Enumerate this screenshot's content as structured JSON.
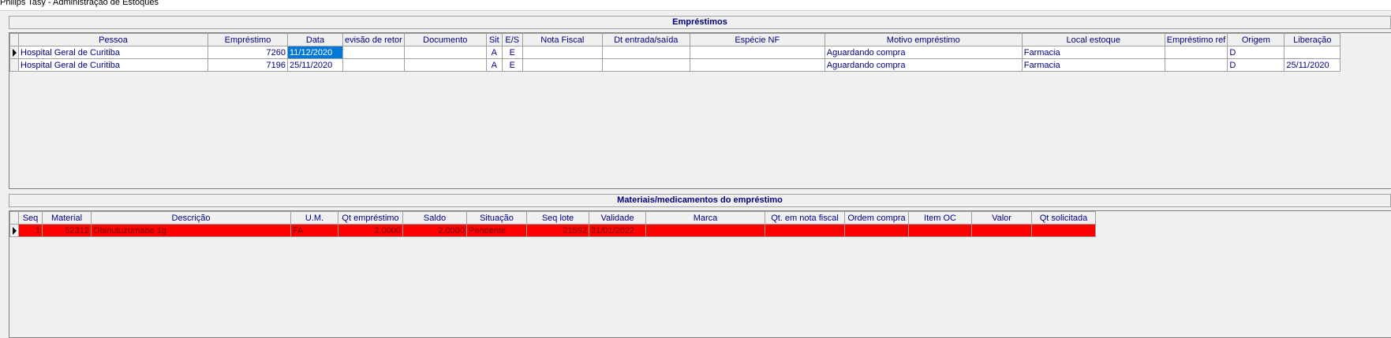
{
  "window": {
    "title": "Philips Tasy - Administração de Estoques"
  },
  "emprestimos": {
    "title": "Empréstimos",
    "columns": [
      "Pessoa",
      "Empréstimo",
      "Data",
      "evisão de retor",
      "Documento",
      "Sit",
      "E/S",
      "Nota Fiscal",
      "Dt entrada/saída",
      "Espécie NF",
      "Motivo empréstimo",
      "Local estoque",
      "Empréstimo ref",
      "Origem",
      "Liberação"
    ],
    "rows": [
      [
        "Hospital Geral de Curitiba",
        "7260",
        "11/12/2020",
        "",
        "",
        "A",
        "E",
        "",
        "",
        "",
        "Aguardando compra",
        "Farmacia",
        "",
        "D",
        ""
      ],
      [
        "Hospital Geral de Curitiba",
        "7196",
        "25/11/2020",
        "",
        "",
        "A",
        "E",
        "",
        "",
        "",
        "Aguardando compra",
        "Farmacia",
        "",
        "D",
        "25/11/2020"
      ]
    ]
  },
  "materiais": {
    "title": "Materiais/medicamentos do empréstimo",
    "columns": [
      "Seq",
      "Material",
      "Descrição",
      "U.M.",
      "Qt empréstimo",
      "Saldo",
      "Situação",
      "Seq lote",
      "Validade",
      "Marca",
      "Qt. em nota fiscal",
      "Ordem compra",
      "Item OC",
      "Valor",
      "Qt solicitada"
    ],
    "rows": [
      [
        "1",
        "52312",
        "Obinutuzumabe 1g",
        "FA",
        "2,0000",
        "2,0000",
        "Pendente",
        "21592",
        "31/01/2022",
        "",
        "",
        "",
        "",
        "",
        ""
      ]
    ]
  },
  "colors": {
    "header_text": "#000080",
    "selected_cell": "#0078d7",
    "pending_row": "#ff0000"
  }
}
